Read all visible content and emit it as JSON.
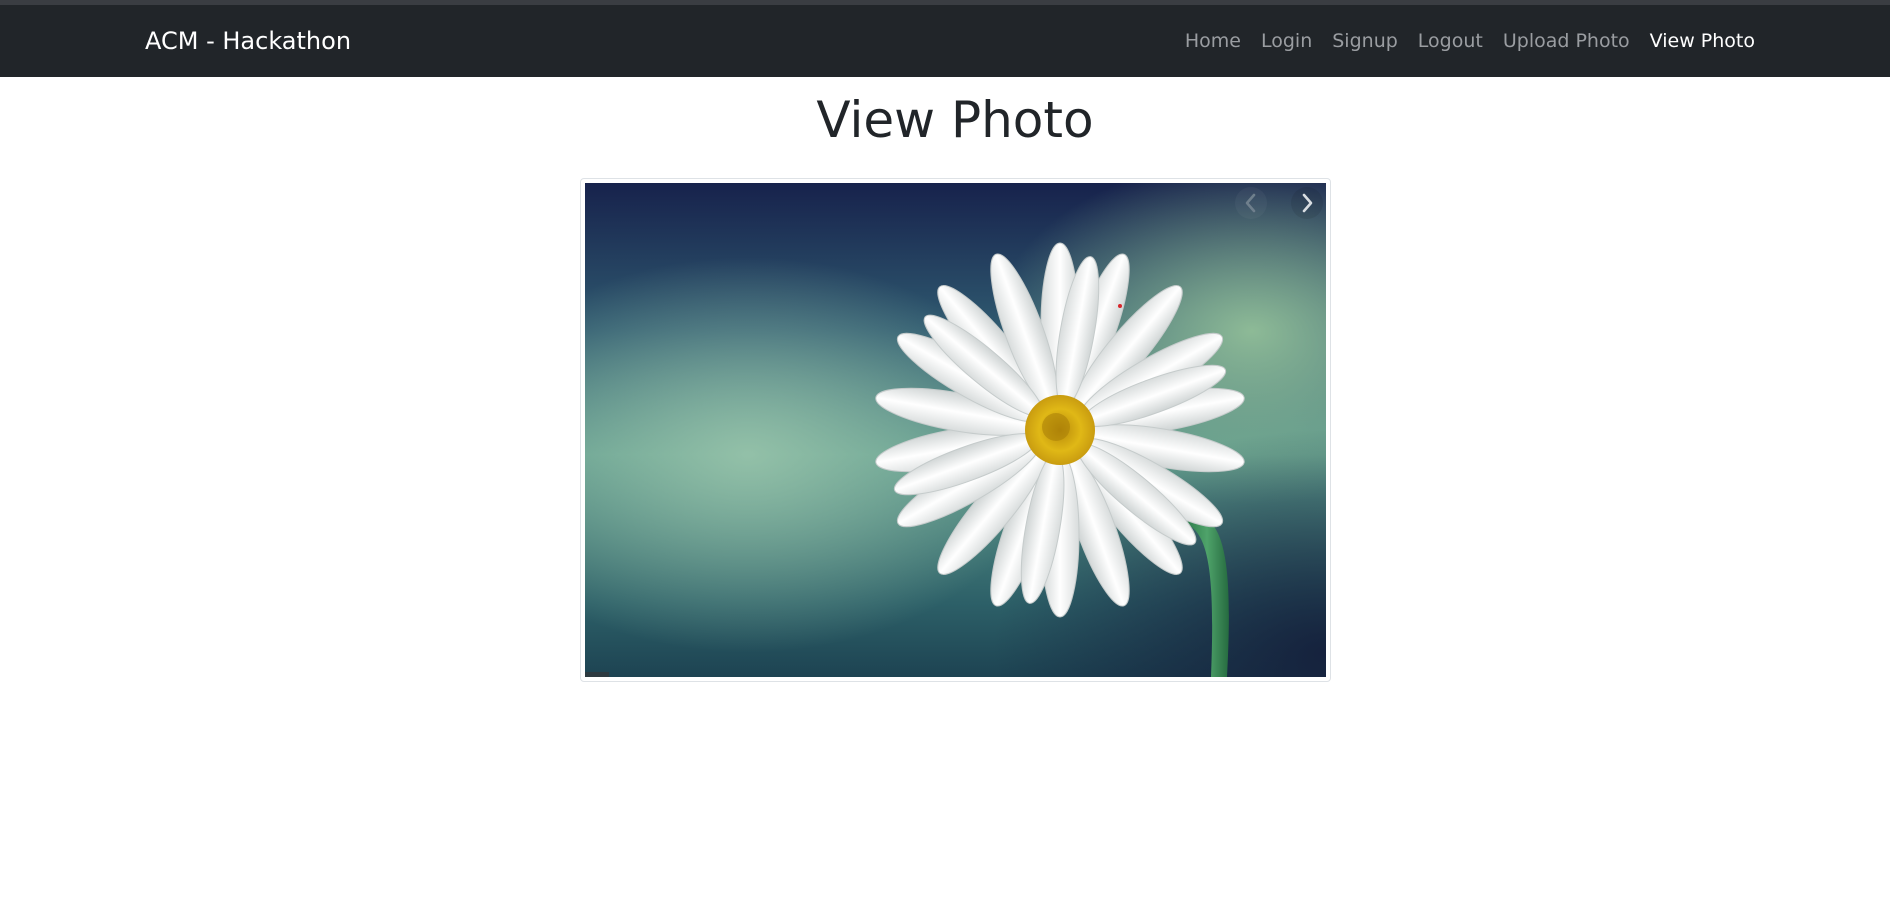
{
  "navbar": {
    "brand": "ACM - Hackathon",
    "links": [
      {
        "label": "Home",
        "active": false
      },
      {
        "label": "Login",
        "active": false
      },
      {
        "label": "Signup",
        "active": false
      },
      {
        "label": "Logout",
        "active": false
      },
      {
        "label": "Upload Photo",
        "active": false
      },
      {
        "label": "View Photo",
        "active": true
      }
    ]
  },
  "main": {
    "title": "View Photo"
  },
  "carousel": {
    "prev_icon": "chevron-left-icon",
    "next_icon": "chevron-right-icon"
  },
  "colors": {
    "navbar_bg": "#212529",
    "nav_inactive": "#9a9da1",
    "nav_active": "#ffffff",
    "title": "#212529"
  }
}
